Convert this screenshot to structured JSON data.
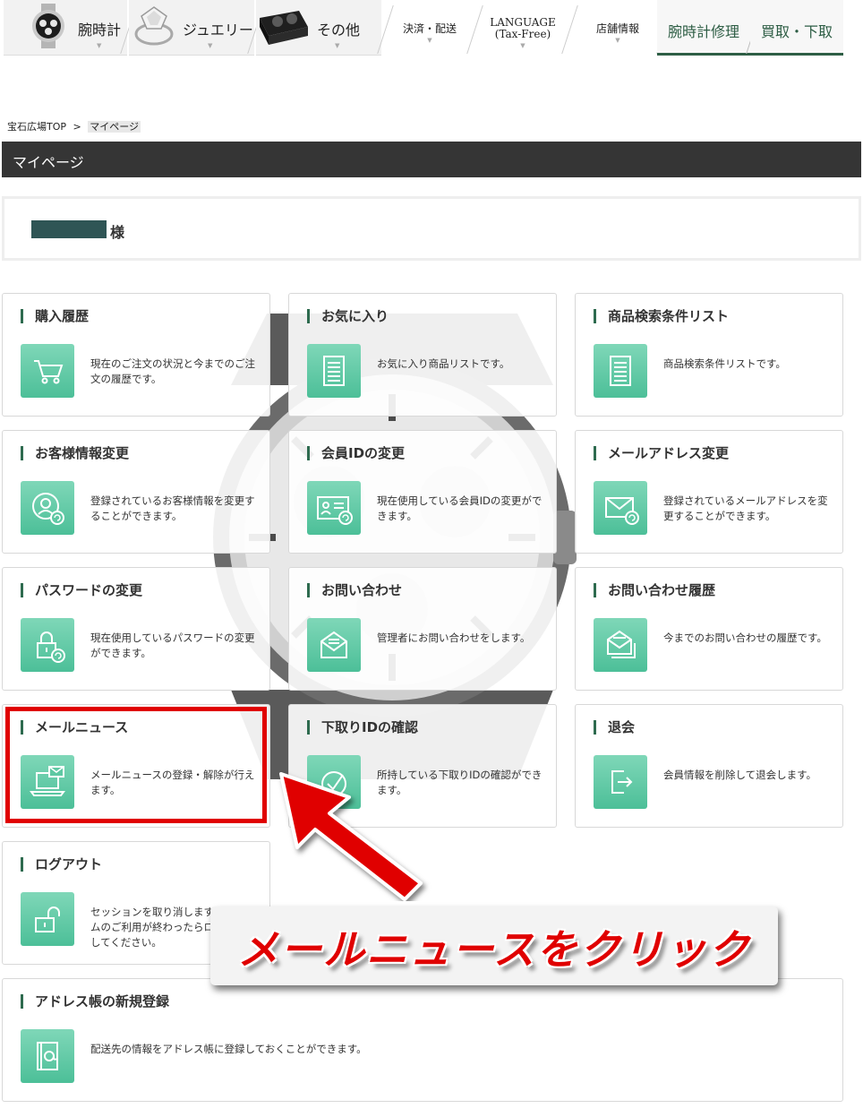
{
  "nav": {
    "items": [
      {
        "label": "腕時計",
        "icon": "watch-thumbnail"
      },
      {
        "label": "ジュエリー",
        "icon": "ring-thumbnail"
      },
      {
        "label": "その他",
        "icon": "watch-box-thumbnail"
      }
    ],
    "text_items": [
      {
        "label": "決済・配送"
      },
      {
        "label": "LANGUAGE",
        "sub": "(Tax-Free)"
      },
      {
        "label": "店舗情報"
      }
    ],
    "green_items": [
      {
        "label": "腕時計修理"
      },
      {
        "label": "買取・下取"
      }
    ]
  },
  "breadcrumb": {
    "home": "宝石広場TOP",
    "separator": ">",
    "current": "マイページ"
  },
  "page_title": "マイページ",
  "user": {
    "honorific": "様"
  },
  "cards": [
    {
      "title": "購入履歴",
      "desc": "現在のご注文の状況と今までのご注文の履歴です。",
      "icon": "cart-icon"
    },
    {
      "title": "お気に入り",
      "desc": "お気に入り商品リストです。",
      "icon": "list-icon"
    },
    {
      "title": "商品検索条件リスト",
      "desc": "商品検索条件リストです。",
      "icon": "list-icon"
    },
    {
      "title": "お客様情報変更",
      "desc": "登録されているお客様情報を変更することができます。",
      "icon": "user-refresh-icon"
    },
    {
      "title": "会員IDの変更",
      "desc": "現在使用している会員IDの変更ができます。",
      "icon": "id-card-refresh-icon"
    },
    {
      "title": "メールアドレス変更",
      "desc": "登録されているメールアドレスを変更することができます。",
      "icon": "mail-refresh-icon"
    },
    {
      "title": "パスワードの変更",
      "desc": "現在使用しているパスワードの変更ができます。",
      "icon": "lock-refresh-icon"
    },
    {
      "title": "お問い合わせ",
      "desc": "管理者にお問い合わせをします。",
      "icon": "inquiry-mail-icon"
    },
    {
      "title": "お問い合わせ履歴",
      "desc": "今までのお問い合わせの履歴です。",
      "icon": "inquiry-history-icon"
    },
    {
      "title": "メールニュース",
      "desc": "メールニュースの登録・解除が行えます。",
      "icon": "laptop-mail-icon"
    },
    {
      "title": "下取りIDの確認",
      "desc": "所持している下取りIDの確認ができます。",
      "icon": "check-circle-icon"
    },
    {
      "title": "退会",
      "desc": "会員情報を削除して退会します。",
      "icon": "exit-icon"
    },
    {
      "title": "ログアウト",
      "desc": "セッションを取り消します。システムのご利用が終わったらログアウトしてください。",
      "icon": "unlock-icon"
    },
    {
      "title": "アドレス帳の新規登録",
      "desc": "配送先の情報をアドレス帳に登録しておくことができます。",
      "icon": "address-book-icon"
    }
  ],
  "callout": {
    "text": "メールニュースをクリック",
    "color": "#e00000"
  },
  "colors": {
    "accent": "#2e6b4f",
    "icon_green": "#5fc8a3",
    "title_bar": "#353535",
    "highlight": "#e00000"
  }
}
